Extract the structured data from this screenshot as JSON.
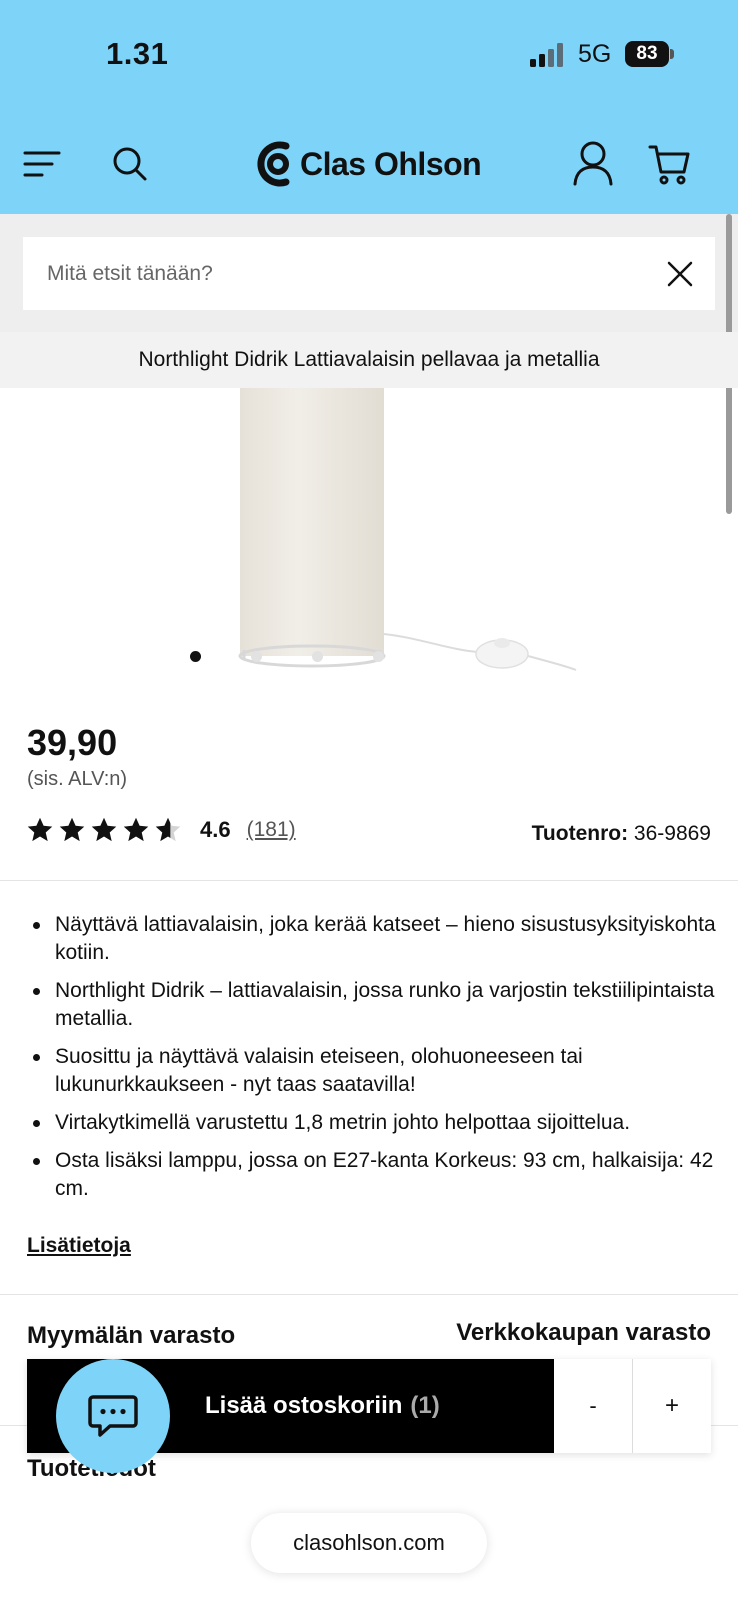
{
  "status_bar": {
    "time": "1.31",
    "network": "5G",
    "battery": "83"
  },
  "header": {
    "brand": "Clas Ohlson",
    "icons": {
      "menu": "hamburger-icon",
      "search": "search-icon",
      "account": "user-icon",
      "cart": "cart-icon"
    },
    "accent_color": "#7dd3f8"
  },
  "search": {
    "placeholder": "Mitä etsit tänään?"
  },
  "product": {
    "title": "Northlight Didrik Lattiavalaisin pellavaa ja metallia",
    "price": "39,90",
    "vat_note": "(sis. ALV:n)",
    "rating": 4.6,
    "rating_text": "4.6",
    "review_count": "(181)",
    "sku_label": "Tuotenro:",
    "sku": "36-9869",
    "image_count": 4,
    "active_image": 0,
    "features": [
      "Näyttävä lattiavalaisin, joka kerää katseet – hieno sisustusyksityiskohta kotiin.",
      "Northlight Didrik – lattiavalaisin, jossa runko ja varjostin tekstiilipintaista metallia.",
      "Suosittu ja näyttävä valaisin eteiseen, olohuoneeseen tai lukunurkkaukseen - nyt taas saatavilla!",
      "Virtakytkimellä varustettu 1,8 metrin johto helpottaa sijoittelua.",
      "Osta lisäksi lamppu, jossa on E27-kanta Korkeus: 93 cm, halkaisija: 42 cm."
    ],
    "more_info": "Lisätietoja"
  },
  "stock": {
    "store": "Myymälän varasto",
    "online": "Verkkokaupan varasto"
  },
  "product_info_heading": "Tuotetiedot",
  "cart_bar": {
    "add_label": "Lisää ostoskoriin",
    "count": "(1)",
    "minus": "-",
    "plus": "+"
  },
  "chat": {
    "icon": "chat-icon"
  },
  "browser": {
    "url": "clasohlson.com"
  }
}
